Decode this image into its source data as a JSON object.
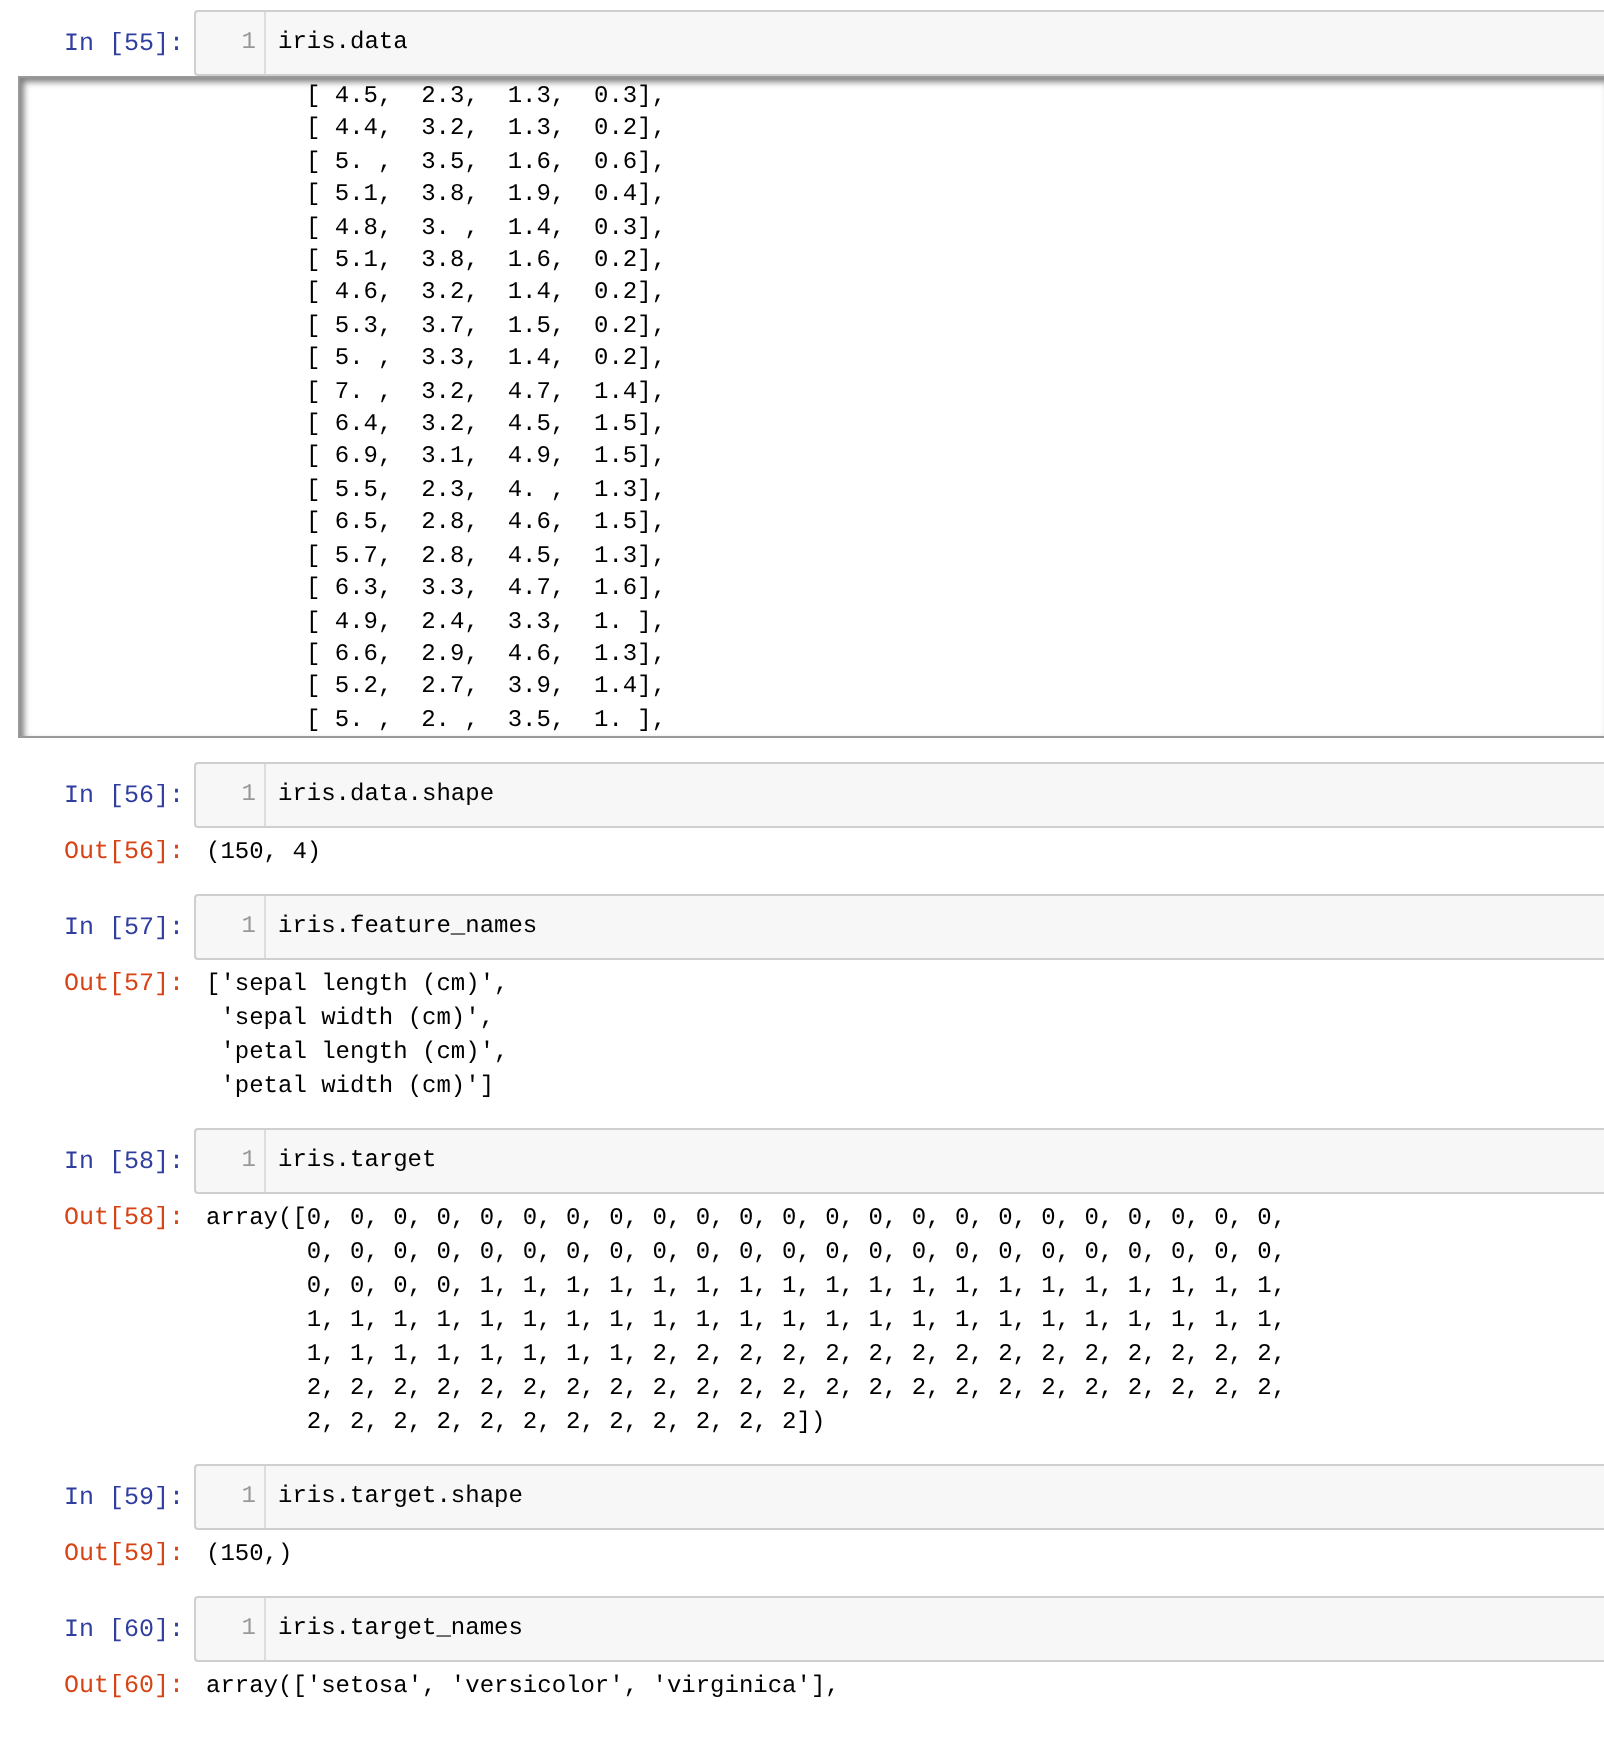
{
  "cells": [
    {
      "in_prompt": "In [55]:",
      "line_number": "1",
      "code": "iris.data",
      "output": {
        "kind": "scrolled",
        "lines": [
          "[ 4.5,  2.3,  1.3,  0.3],",
          "[ 4.4,  3.2,  1.3,  0.2],",
          "[ 5. ,  3.5,  1.6,  0.6],",
          "[ 5.1,  3.8,  1.9,  0.4],",
          "[ 4.8,  3. ,  1.4,  0.3],",
          "[ 5.1,  3.8,  1.6,  0.2],",
          "[ 4.6,  3.2,  1.4,  0.2],",
          "[ 5.3,  3.7,  1.5,  0.2],",
          "[ 5. ,  3.3,  1.4,  0.2],",
          "[ 7. ,  3.2,  4.7,  1.4],",
          "[ 6.4,  3.2,  4.5,  1.5],",
          "[ 6.9,  3.1,  4.9,  1.5],",
          "[ 5.5,  2.3,  4. ,  1.3],",
          "[ 6.5,  2.8,  4.6,  1.5],",
          "[ 5.7,  2.8,  4.5,  1.3],",
          "[ 6.3,  3.3,  4.7,  1.6],",
          "[ 4.9,  2.4,  3.3,  1. ],",
          "[ 6.6,  2.9,  4.6,  1.3],",
          "[ 5.2,  2.7,  3.9,  1.4],",
          "[ 5. ,  2. ,  3.5,  1. ],"
        ]
      }
    },
    {
      "in_prompt": "In [56]:",
      "line_number": "1",
      "code": "iris.data.shape",
      "output": {
        "kind": "plain",
        "prompt": "Out[56]:",
        "lines": [
          "(150, 4)"
        ]
      }
    },
    {
      "in_prompt": "In [57]:",
      "line_number": "1",
      "code": "iris.feature_names",
      "output": {
        "kind": "plain",
        "prompt": "Out[57]:",
        "lines": [
          "['sepal length (cm)',",
          " 'sepal width (cm)',",
          " 'petal length (cm)',",
          " 'petal width (cm)']"
        ]
      }
    },
    {
      "in_prompt": "In [58]:",
      "line_number": "1",
      "code": "iris.target",
      "output": {
        "kind": "plain",
        "prompt": "Out[58]:",
        "lines": [
          "array([0, 0, 0, 0, 0, 0, 0, 0, 0, 0, 0, 0, 0, 0, 0, 0, 0, 0, 0, 0, 0, 0, 0,",
          "       0, 0, 0, 0, 0, 0, 0, 0, 0, 0, 0, 0, 0, 0, 0, 0, 0, 0, 0, 0, 0, 0, 0,",
          "       0, 0, 0, 0, 1, 1, 1, 1, 1, 1, 1, 1, 1, 1, 1, 1, 1, 1, 1, 1, 1, 1, 1,",
          "       1, 1, 1, 1, 1, 1, 1, 1, 1, 1, 1, 1, 1, 1, 1, 1, 1, 1, 1, 1, 1, 1, 1,",
          "       1, 1, 1, 1, 1, 1, 1, 1, 2, 2, 2, 2, 2, 2, 2, 2, 2, 2, 2, 2, 2, 2, 2,",
          "       2, 2, 2, 2, 2, 2, 2, 2, 2, 2, 2, 2, 2, 2, 2, 2, 2, 2, 2, 2, 2, 2, 2,",
          "       2, 2, 2, 2, 2, 2, 2, 2, 2, 2, 2, 2])"
        ]
      }
    },
    {
      "in_prompt": "In [59]:",
      "line_number": "1",
      "code": "iris.target.shape",
      "output": {
        "kind": "plain",
        "prompt": "Out[59]:",
        "lines": [
          "(150,)"
        ]
      }
    },
    {
      "in_prompt": "In [60]:",
      "line_number": "1",
      "code": "iris.target_names",
      "output": {
        "kind": "plain",
        "prompt": "Out[60]:",
        "lines": [
          "array(['setosa', 'versicolor', 'virginica'],"
        ]
      }
    }
  ]
}
